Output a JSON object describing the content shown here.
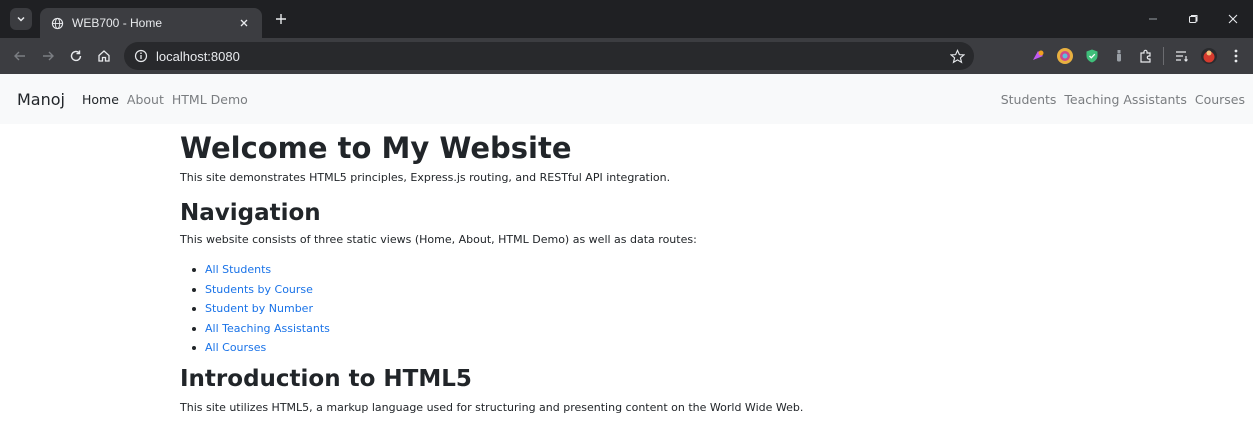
{
  "browser": {
    "tab_title": "WEB700 - Home",
    "url": "localhost:8080"
  },
  "navbar": {
    "brand": "Manoj",
    "left_links": [
      "Home",
      "About",
      "HTML Demo"
    ],
    "right_links": [
      "Students",
      "Teaching Assistants",
      "Courses"
    ]
  },
  "content": {
    "title": "Welcome to My Website",
    "intro": "This site demonstrates HTML5 principles, Express.js routing, and RESTful API integration.",
    "nav_heading": "Navigation",
    "nav_text": "This website consists of three static views (Home, About, HTML Demo) as well as data routes:",
    "links": [
      "All Students",
      "Students by Course",
      "Student by Number",
      "All Teaching Assistants",
      "All Courses"
    ],
    "html5_heading": "Introduction to HTML5",
    "html5_text": "This site utilizes HTML5, a markup language used for structuring and presenting content on the World Wide Web."
  },
  "colors": {
    "link": "#1a73e8",
    "chrome_dark": "#1f2023",
    "chrome_toolbar": "#3c3d41"
  }
}
